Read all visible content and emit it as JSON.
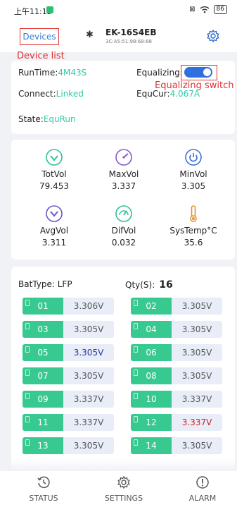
{
  "status_bar": {
    "time": "上午11:15",
    "battery": "86"
  },
  "header": {
    "devices_label": "Devices",
    "device_name": "EK-16S4EB",
    "device_mac": "3C:A5:51:98:68:88"
  },
  "annotations": {
    "device_list": "Device list",
    "equalizing_switch": "Equalizing switch"
  },
  "info": {
    "runtime_label": "RunTime:",
    "runtime_value": "4M43S",
    "connect_label": "Connect:",
    "connect_value": "Linked",
    "state_label": "State:",
    "state_value": "EquRun",
    "equalizing_label": "Equalizing:",
    "equalizing_on": true,
    "equcur_label": "EquCur:",
    "equcur_value": "4.067A"
  },
  "stats": [
    {
      "label": "TotVol",
      "value": "79.453",
      "icon": "check-circle-icon"
    },
    {
      "label": "MaxVol",
      "value": "3.337",
      "icon": "gauge-high-icon"
    },
    {
      "label": "MinVol",
      "value": "3.305",
      "icon": "power-circle-icon"
    },
    {
      "label": "AvgVol",
      "value": "3.311",
      "icon": "down-chevron-circle-icon"
    },
    {
      "label": "DifVol",
      "value": "0.032",
      "icon": "speedometer-icon"
    },
    {
      "label": "SysTemp°C",
      "value": "35.6",
      "icon": "thermometer-icon"
    }
  ],
  "battery": {
    "type_label": "BatType:",
    "type_value": "LFP",
    "qty_label": "Qty(S):",
    "qty_value": "16"
  },
  "cells": [
    {
      "index": "01",
      "voltage": "3.306V",
      "style": "normal"
    },
    {
      "index": "02",
      "voltage": "3.305V",
      "style": "normal"
    },
    {
      "index": "03",
      "voltage": "3.305V",
      "style": "normal"
    },
    {
      "index": "04",
      "voltage": "3.305V",
      "style": "normal"
    },
    {
      "index": "05",
      "voltage": "3.305V",
      "style": "blue"
    },
    {
      "index": "06",
      "voltage": "3.305V",
      "style": "normal"
    },
    {
      "index": "07",
      "voltage": "3.305V",
      "style": "normal"
    },
    {
      "index": "08",
      "voltage": "3.305V",
      "style": "normal"
    },
    {
      "index": "09",
      "voltage": "3.337V",
      "style": "normal"
    },
    {
      "index": "10",
      "voltage": "3.337V",
      "style": "normal"
    },
    {
      "index": "11",
      "voltage": "3.337V",
      "style": "normal"
    },
    {
      "index": "12",
      "voltage": "3.337V",
      "style": "red"
    },
    {
      "index": "13",
      "voltage": "3.305V",
      "style": "normal"
    },
    {
      "index": "14",
      "voltage": "3.305V",
      "style": "normal"
    }
  ],
  "nav": {
    "status": "STATUS",
    "settings": "SETTINGS",
    "alarm": "ALARM"
  }
}
